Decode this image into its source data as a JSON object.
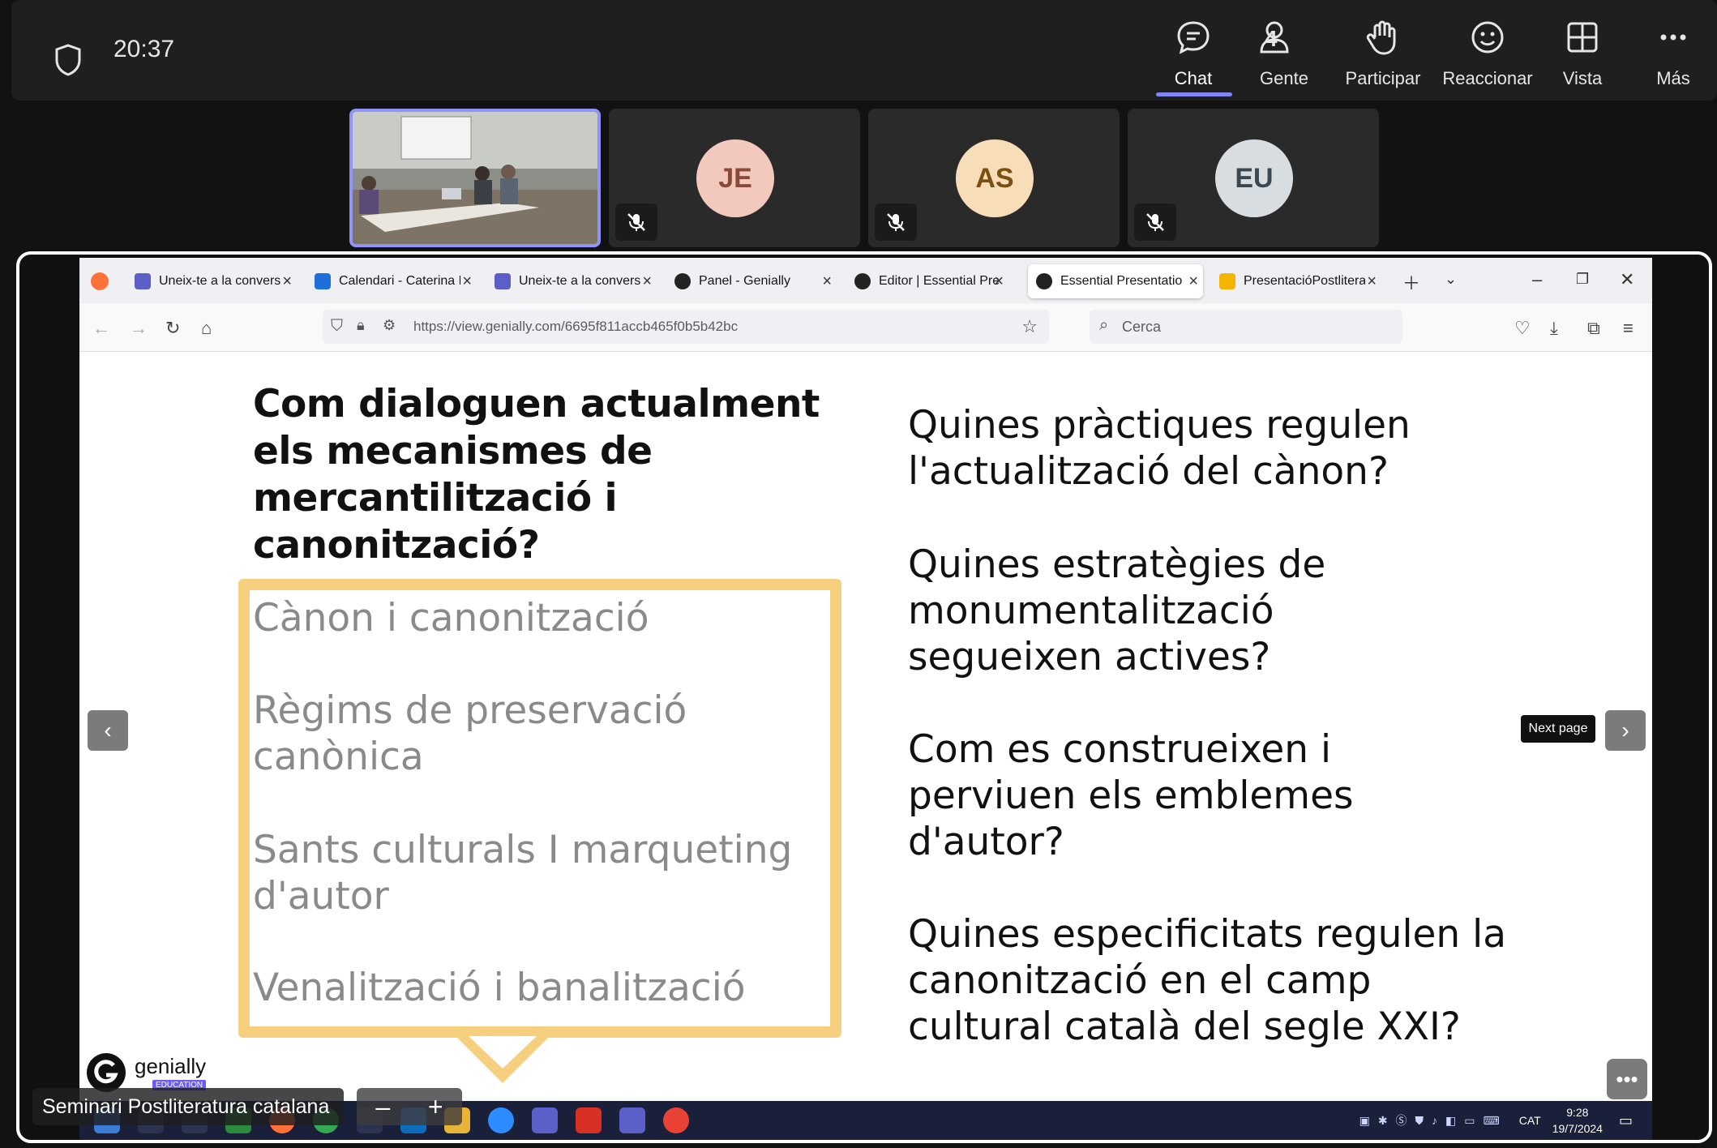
{
  "teams": {
    "time": "20:37",
    "toolbar": [
      {
        "key": "chat",
        "label": "Chat",
        "icon": "chat-icon"
      },
      {
        "key": "people",
        "label": "Gente",
        "icon": "people-icon",
        "count": "4"
      },
      {
        "key": "raise",
        "label": "Participar",
        "icon": "raise-hand-icon"
      },
      {
        "key": "react",
        "label": "Reaccionar",
        "icon": "smiley-icon"
      },
      {
        "key": "view",
        "label": "Vista",
        "icon": "grid-icon"
      },
      {
        "key": "more",
        "label": "Más",
        "icon": "more-icon"
      }
    ],
    "participants": [
      {
        "initials": "JE",
        "bg": "#f3c9bd",
        "fg": "#8a4a3a"
      },
      {
        "initials": "AS",
        "bg": "#f7ddb8",
        "fg": "#7a4f12"
      },
      {
        "initials": "EU",
        "bg": "#d7dde0",
        "fg": "#3b4852"
      }
    ],
    "meeting_title": "Seminari Postliteratura catalana",
    "accent": "#7f85f5"
  },
  "browser": {
    "tabs": [
      {
        "label": "Uneix-te a la conversa",
        "icon_color": "#5b5fc7"
      },
      {
        "label": "Calendari - Caterina M",
        "icon_color": "#1e6fd9"
      },
      {
        "label": "Uneix-te a la conversa",
        "icon_color": "#5b5fc7"
      },
      {
        "label": "Panel - Genially",
        "icon_color": "#222222"
      },
      {
        "label": "Editor | Essential Prese",
        "icon_color": "#222222"
      },
      {
        "label": "Essential Presentation",
        "icon_color": "#222222"
      },
      {
        "label": "PresentacióPostliteratu",
        "icon_color": "#f4b400"
      }
    ],
    "url_host": "https://view.genially.com",
    "url_path": "/6695f811accb465f0b5b42bc",
    "search_placeholder": "Cerca"
  },
  "slide": {
    "title": "Com dialoguen actualment els mecanismes de mercantilització i canonització?",
    "topics": [
      "Cànon i canonització",
      "Règims de preservació canònica",
      "Sants culturals I marqueting d'autor",
      "Venalització i banalització"
    ],
    "questions": [
      "Quines pràctiques regulen l'actualització del cànon?",
      "Quines estratègies de monumentalització segueixen actives?",
      "Com es construeixen i perviuen els emblemes d'autor?",
      "Quines especificitats regulen la canonització en el camp cultural català del segle XXI?"
    ],
    "tooltip": "Next page",
    "box_color": "#f6d07f",
    "logo": {
      "word": "genially",
      "badge": "EDUCATION"
    }
  },
  "taskbar": {
    "lang": "CAT",
    "time": "9:28",
    "date": "19/7/2024"
  }
}
